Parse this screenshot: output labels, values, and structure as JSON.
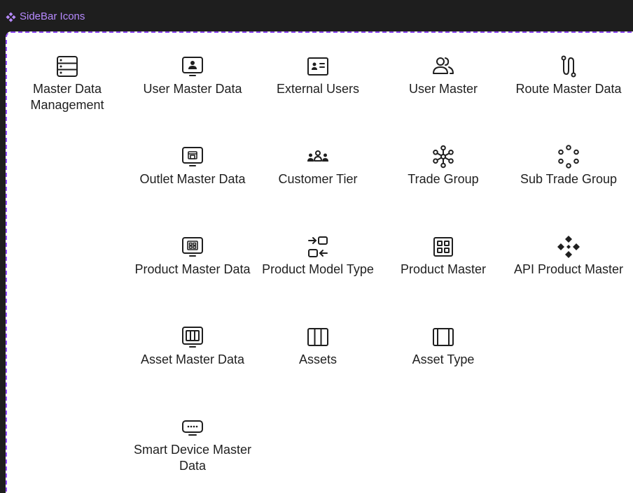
{
  "frame": {
    "title": "SideBar Icons",
    "title_icon": "component-diamond-icon",
    "accent": "#8f4bf5"
  },
  "items": [
    {
      "label": "Master Data Management",
      "icon": "server-list-icon"
    },
    {
      "label": "User Master Data",
      "icon": "monitor-user-icon"
    },
    {
      "label": "External Users",
      "icon": "id-card-icon"
    },
    {
      "label": "User Master",
      "icon": "users-icon"
    },
    {
      "label": "Route Master Data",
      "icon": "route-icon"
    },
    {
      "label": "Outlet Master Data",
      "icon": "monitor-store-icon"
    },
    {
      "label": "Customer Tier",
      "icon": "user-group-icon"
    },
    {
      "label": "Trade Group",
      "icon": "network-cluster-icon"
    },
    {
      "label": "Sub Trade Group",
      "icon": "dots-circle-icon"
    },
    {
      "label": "Product Master Data",
      "icon": "monitor-grid-icon"
    },
    {
      "label": "Product Model Type",
      "icon": "swap-boxes-icon"
    },
    {
      "label": "Product Master",
      "icon": "grid-box-icon"
    },
    {
      "label": "API Product Master",
      "icon": "api-diamond-icon"
    },
    {
      "label": "Asset Master Data",
      "icon": "monitor-columns-icon"
    },
    {
      "label": "Assets",
      "icon": "columns-three-icon"
    },
    {
      "label": "Asset Type",
      "icon": "columns-two-icon"
    },
    {
      "label": "Smart Device Master Data",
      "icon": "smart-device-icon"
    }
  ]
}
